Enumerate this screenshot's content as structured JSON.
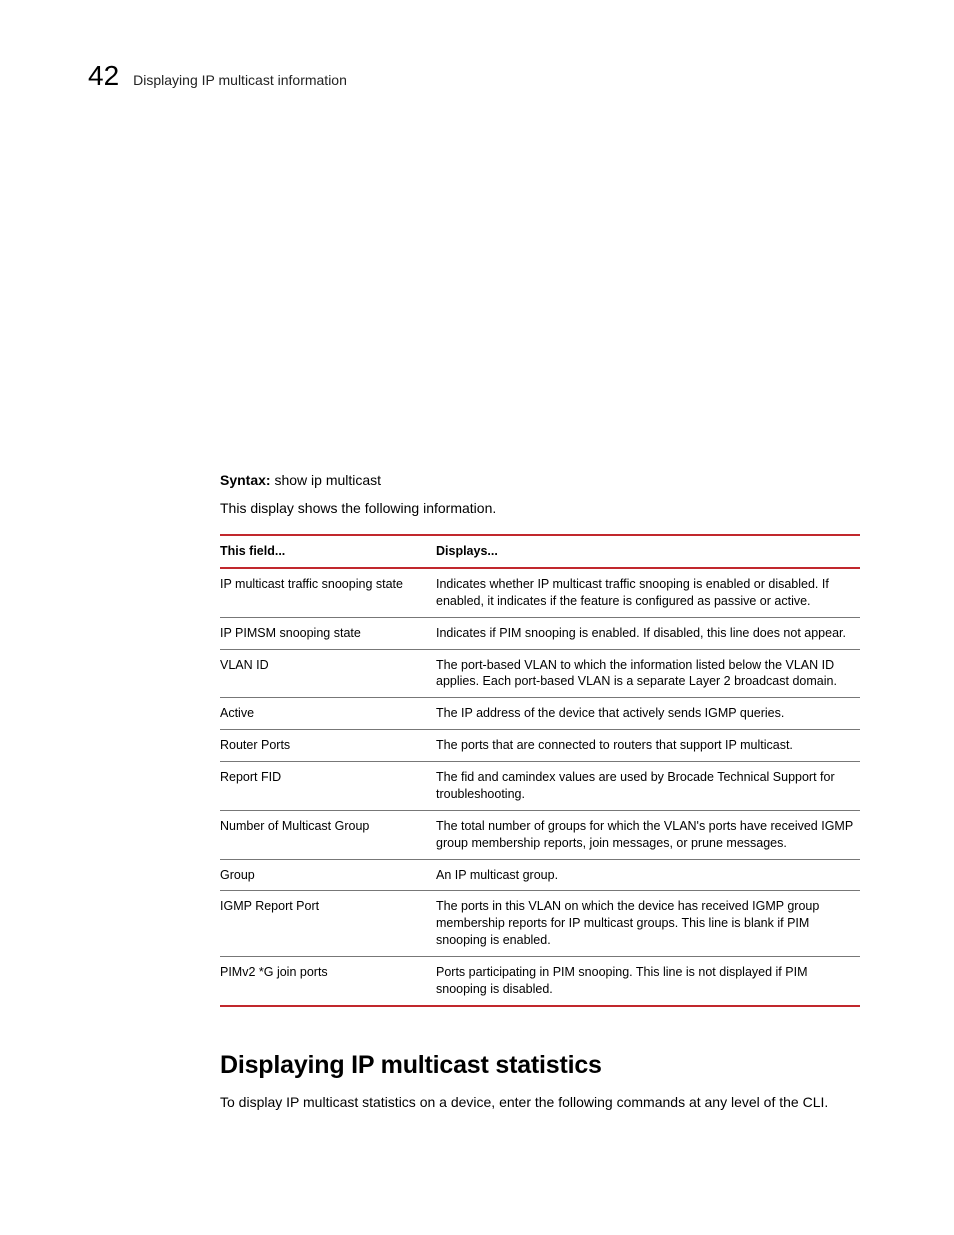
{
  "header": {
    "page_number": "42",
    "title": "Displaying IP multicast information"
  },
  "syntax": {
    "label": "Syntax:",
    "command": "show ip multicast"
  },
  "intro": "This display shows the following information.",
  "table": {
    "head": {
      "col1": "This field...",
      "col2": "Displays..."
    },
    "rows": [
      {
        "field": "IP multicast traffic snooping state",
        "desc": "Indicates whether IP multicast traffic snooping is enabled or disabled. If enabled, it indicates if the feature is configured as passive or active."
      },
      {
        "field": "IP PIMSM snooping state",
        "desc": "Indicates if PIM snooping is enabled. If disabled, this line does not appear."
      },
      {
        "field": "VLAN ID",
        "desc": "The port-based VLAN to which the information listed below the VLAN ID applies.  Each port-based VLAN is a separate Layer 2 broadcast domain."
      },
      {
        "field": "Active",
        "desc": "The IP address of the device that actively sends IGMP queries."
      },
      {
        "field": "Router Ports",
        "desc": "The ports that are connected to routers that support IP multicast."
      },
      {
        "field": "Report FID",
        "desc": "The fid and camindex values are used by Brocade Technical Support for troubleshooting."
      },
      {
        "field": "Number of Multicast Group",
        "desc": "The total number of groups for which the VLAN's ports have received IGMP group membership reports, join messages, or prune messages."
      },
      {
        "field": "Group",
        "desc": "An IP multicast group."
      },
      {
        "field": "IGMP Report Port",
        "desc": "The ports in this VLAN on which the device has received IGMP group membership reports for IP multicast groups. This line is blank if PIM snooping is enabled."
      },
      {
        "field": "PIMv2 *G join ports",
        "desc": "Ports participating in PIM snooping. This line is not displayed if PIM snooping is disabled."
      }
    ]
  },
  "section": {
    "heading": "Displaying IP multicast statistics",
    "body": "To display IP multicast statistics on a device, enter the following commands at any level of the CLI."
  }
}
